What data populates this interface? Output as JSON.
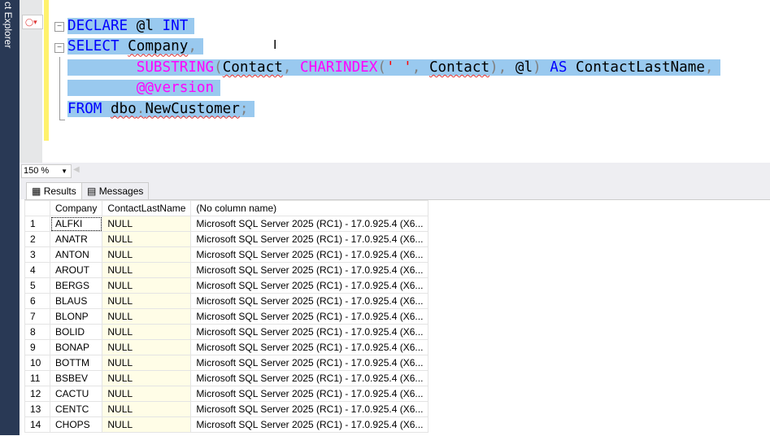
{
  "sidebar": {
    "label": "ct Explorer"
  },
  "editor": {
    "lines": [
      [
        {
          "t": "DECLARE",
          "c": "kw"
        },
        {
          "t": " @l ",
          "c": "id"
        },
        {
          "t": "INT",
          "c": "kw"
        }
      ],
      [
        {
          "t": "SELECT",
          "c": "kw"
        },
        {
          "t": " ",
          "c": "id"
        },
        {
          "t": "Company",
          "c": "id sq"
        },
        {
          "t": ",",
          "c": "gr"
        }
      ],
      [
        {
          "t": "        ",
          "c": "id"
        },
        {
          "t": "SUBSTRING",
          "c": "fn"
        },
        {
          "t": "(",
          "c": "gr"
        },
        {
          "t": "Contact",
          "c": "id sq"
        },
        {
          "t": ", ",
          "c": "gr"
        },
        {
          "t": "CHARINDEX",
          "c": "fn"
        },
        {
          "t": "(",
          "c": "gr"
        },
        {
          "t": "' '",
          "c": "str"
        },
        {
          "t": ", ",
          "c": "gr"
        },
        {
          "t": "Contact",
          "c": "id sq"
        },
        {
          "t": "), ",
          "c": "gr"
        },
        {
          "t": "@l",
          "c": "id"
        },
        {
          "t": ") ",
          "c": "gr"
        },
        {
          "t": "AS",
          "c": "kw"
        },
        {
          "t": " ContactLastName",
          "c": "id"
        },
        {
          "t": ",",
          "c": "gr"
        }
      ],
      [
        {
          "t": "        ",
          "c": "id"
        },
        {
          "t": "@@version",
          "c": "fn"
        }
      ],
      [
        {
          "t": "FROM",
          "c": "kw"
        },
        {
          "t": " ",
          "c": "id"
        },
        {
          "t": "dbo",
          "c": "id sq"
        },
        {
          "t": ".",
          "c": "gr sq"
        },
        {
          "t": "NewCustomer",
          "c": "id sq"
        },
        {
          "t": ";",
          "c": "gr"
        }
      ]
    ]
  },
  "zoom": {
    "value": "150 %"
  },
  "tabs": {
    "results": "Results",
    "messages": "Messages"
  },
  "grid": {
    "columns": [
      "",
      "Company",
      "ContactLastName",
      "(No column name)"
    ],
    "rows": [
      [
        "1",
        "ALFKI",
        "NULL",
        "Microsoft SQL Server 2025 (RC1) - 17.0.925.4 (X6..."
      ],
      [
        "2",
        "ANATR",
        "NULL",
        "Microsoft SQL Server 2025 (RC1) - 17.0.925.4 (X6..."
      ],
      [
        "3",
        "ANTON",
        "NULL",
        "Microsoft SQL Server 2025 (RC1) - 17.0.925.4 (X6..."
      ],
      [
        "4",
        "AROUT",
        "NULL",
        "Microsoft SQL Server 2025 (RC1) - 17.0.925.4 (X6..."
      ],
      [
        "5",
        "BERGS",
        "NULL",
        "Microsoft SQL Server 2025 (RC1) - 17.0.925.4 (X6..."
      ],
      [
        "6",
        "BLAUS",
        "NULL",
        "Microsoft SQL Server 2025 (RC1) - 17.0.925.4 (X6..."
      ],
      [
        "7",
        "BLONP",
        "NULL",
        "Microsoft SQL Server 2025 (RC1) - 17.0.925.4 (X6..."
      ],
      [
        "8",
        "BOLID",
        "NULL",
        "Microsoft SQL Server 2025 (RC1) - 17.0.925.4 (X6..."
      ],
      [
        "9",
        "BONAP",
        "NULL",
        "Microsoft SQL Server 2025 (RC1) - 17.0.925.4 (X6..."
      ],
      [
        "10",
        "BOTTM",
        "NULL",
        "Microsoft SQL Server 2025 (RC1) - 17.0.925.4 (X6..."
      ],
      [
        "11",
        "BSBEV",
        "NULL",
        "Microsoft SQL Server 2025 (RC1) - 17.0.925.4 (X6..."
      ],
      [
        "12",
        "CACTU",
        "NULL",
        "Microsoft SQL Server 2025 (RC1) - 17.0.925.4 (X6..."
      ],
      [
        "13",
        "CENTC",
        "NULL",
        "Microsoft SQL Server 2025 (RC1) - 17.0.925.4 (X6..."
      ],
      [
        "14",
        "CHOPS",
        "NULL",
        "Microsoft SQL Server 2025 (RC1) - 17.0.925.4 (X6..."
      ]
    ]
  }
}
